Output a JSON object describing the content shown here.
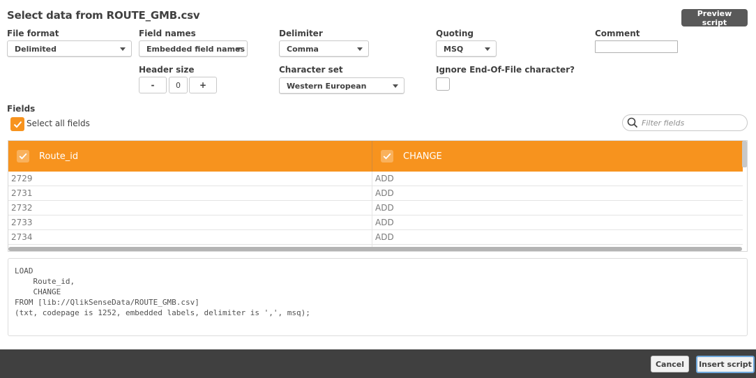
{
  "dialog": {
    "title": "Select data from ROUTE_GMB.csv",
    "preview_label": "Preview script"
  },
  "options": {
    "file_format": {
      "label": "File format",
      "value": "Delimited"
    },
    "field_names": {
      "label": "Field names",
      "value": "Embedded field names"
    },
    "delimiter": {
      "label": "Delimiter",
      "value": "Comma"
    },
    "quoting": {
      "label": "Quoting",
      "value": "MSQ"
    },
    "comment": {
      "label": "Comment",
      "value": ""
    },
    "header_size": {
      "label": "Header size",
      "value": "0",
      "minus": "-",
      "plus": "+"
    },
    "character_set": {
      "label": "Character set",
      "value": "Western European"
    },
    "ignore_eof": {
      "label": "Ignore End-Of-File character?",
      "checked": false
    }
  },
  "fields": {
    "label": "Fields",
    "select_all_label": "Select all fields",
    "select_all_checked": true,
    "filter_placeholder": "Filter fields"
  },
  "grid": {
    "columns": [
      "Route_id",
      "CHANGE"
    ],
    "rows": [
      [
        "2729",
        "ADD"
      ],
      [
        "2731",
        "ADD"
      ],
      [
        "2732",
        "ADD"
      ],
      [
        "2733",
        "ADD"
      ],
      [
        "2734",
        "ADD"
      ],
      [
        "",
        ""
      ]
    ]
  },
  "script": {
    "text": "LOAD\n    Route_id,\n    CHANGE\nFROM [lib://QlikSenseData/ROUTE_GMB.csv]\n(txt, codepage is 1252, embedded labels, delimiter is ',', msq);"
  },
  "footer": {
    "cancel_label": "Cancel",
    "insert_label": "Insert script"
  },
  "colors": {
    "accent": "#f7931e",
    "footer_bg": "#404040",
    "preview_bg": "#595959"
  }
}
